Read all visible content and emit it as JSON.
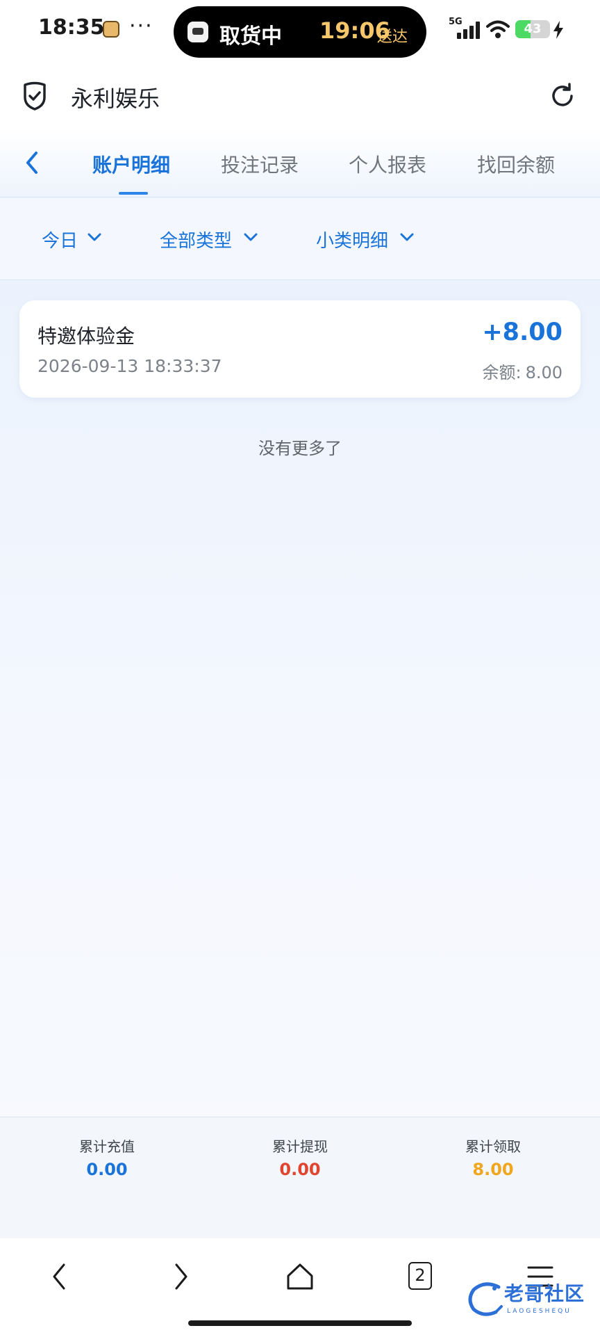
{
  "status_bar": {
    "time": "18:35",
    "more": "···",
    "island_left": "取货中",
    "island_eta": "19:06",
    "island_eta_label": "送达",
    "network": "5G",
    "battery": "43",
    "battery_level": 0.43
  },
  "header": {
    "title": "永利娱乐"
  },
  "tabs": [
    {
      "label": "账户明细",
      "active": true
    },
    {
      "label": "投注记录",
      "active": false
    },
    {
      "label": "个人报表",
      "active": false
    },
    {
      "label": "找回余额",
      "active": false
    }
  ],
  "filters": [
    {
      "label": "今日"
    },
    {
      "label": "全部类型"
    },
    {
      "label": "小类明细"
    }
  ],
  "records": [
    {
      "title": "特邀体验金",
      "time": "2026-09-13 18:33:37",
      "amount": "+8.00",
      "balance_label": "余额:",
      "balance": "8.00"
    }
  ],
  "no_more": "没有更多了",
  "summary": [
    {
      "label": "累计充值",
      "value": "0.00",
      "color": "#1a73d9"
    },
    {
      "label": "累计提现",
      "value": "0.00",
      "color": "#e0452f"
    },
    {
      "label": "累计领取",
      "value": "8.00",
      "color": "#f0a61d"
    }
  ],
  "browser": {
    "tab_count": "2"
  },
  "watermark": {
    "text": "老哥社区",
    "sub": "LAOGESHEQU"
  },
  "colors": {
    "accent": "#1a73d9"
  }
}
